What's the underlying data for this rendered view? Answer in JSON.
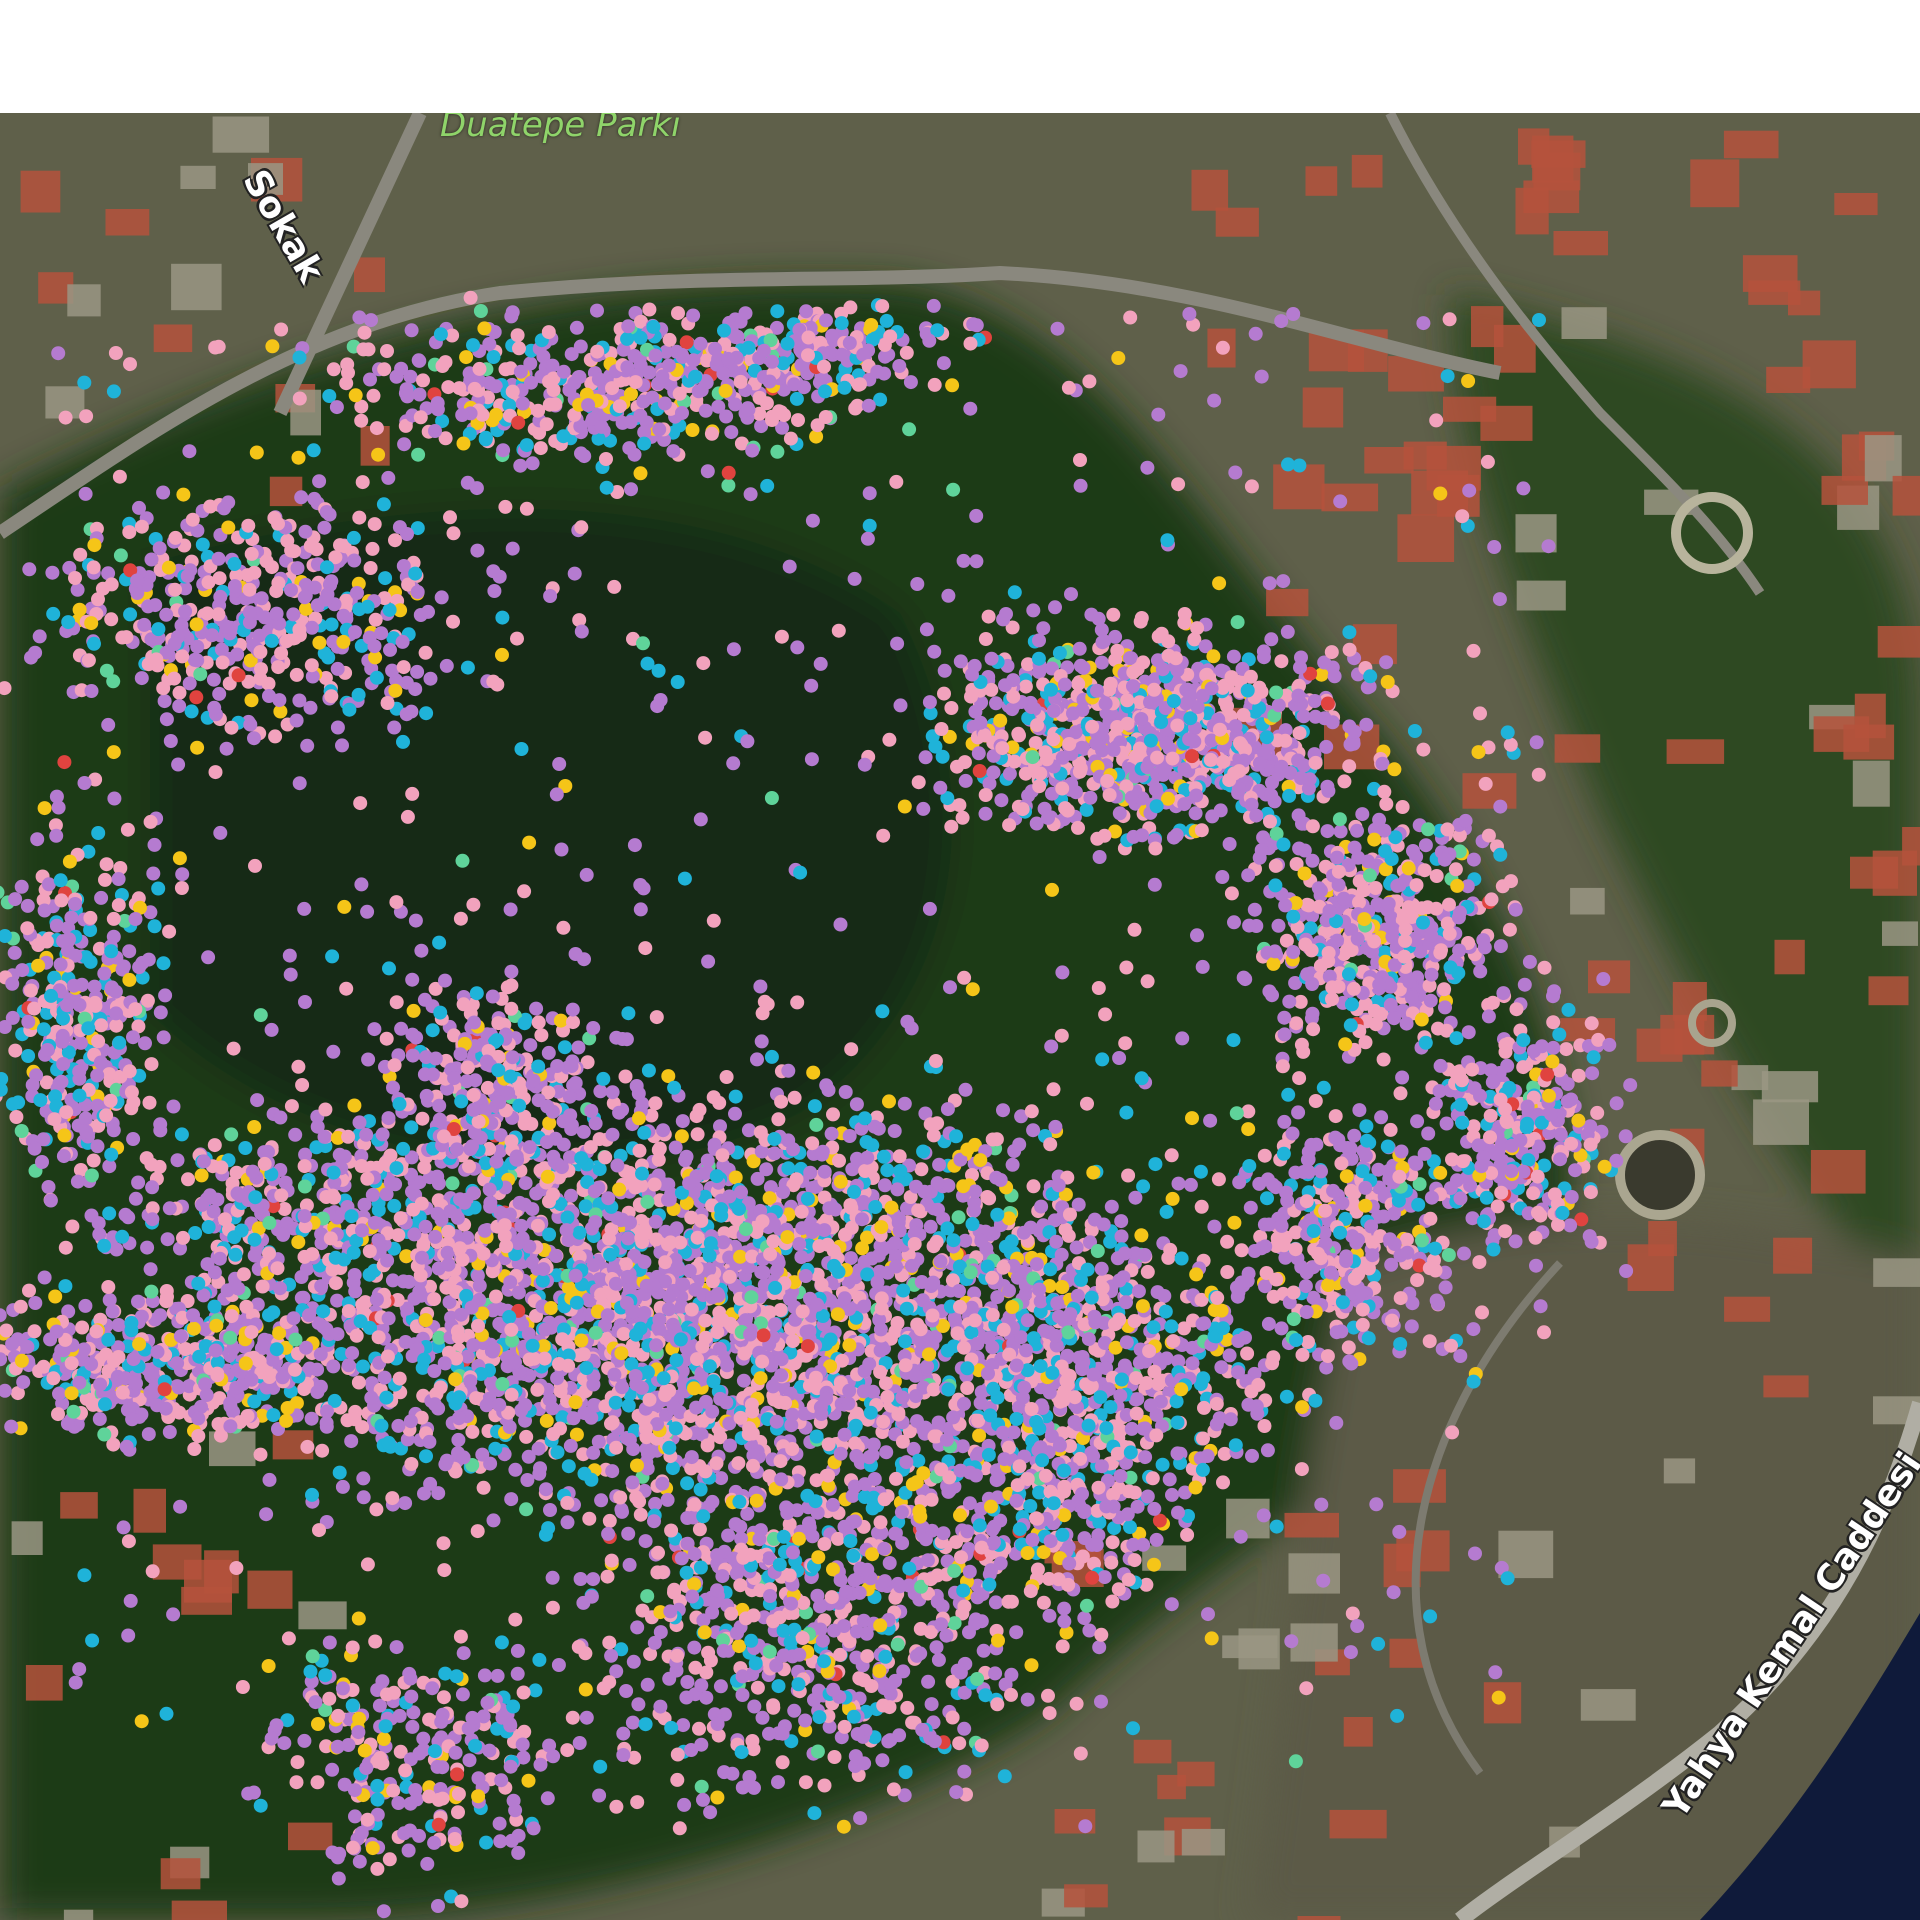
{
  "map": {
    "labels": {
      "park": "Duatepe Parkı",
      "street_top": "Sokak",
      "street_bottom": "Yahya Kemal Caddesi"
    },
    "colors": {
      "forest": "#1f3a1a",
      "forest_dark": "#132611",
      "urban": "#6a6650",
      "roof": "#b5523c",
      "road": "#8c8a80",
      "water": "#101a38",
      "pool": "#4fb3d8"
    },
    "points": {
      "palette": [
        "#b57bd0",
        "#f2a2bd",
        "#1fb3d9",
        "#f5c518",
        "#5fd39a",
        "#e0433f"
      ],
      "weights": [
        0.46,
        0.3,
        0.15,
        0.06,
        0.02,
        0.01
      ]
    }
  }
}
